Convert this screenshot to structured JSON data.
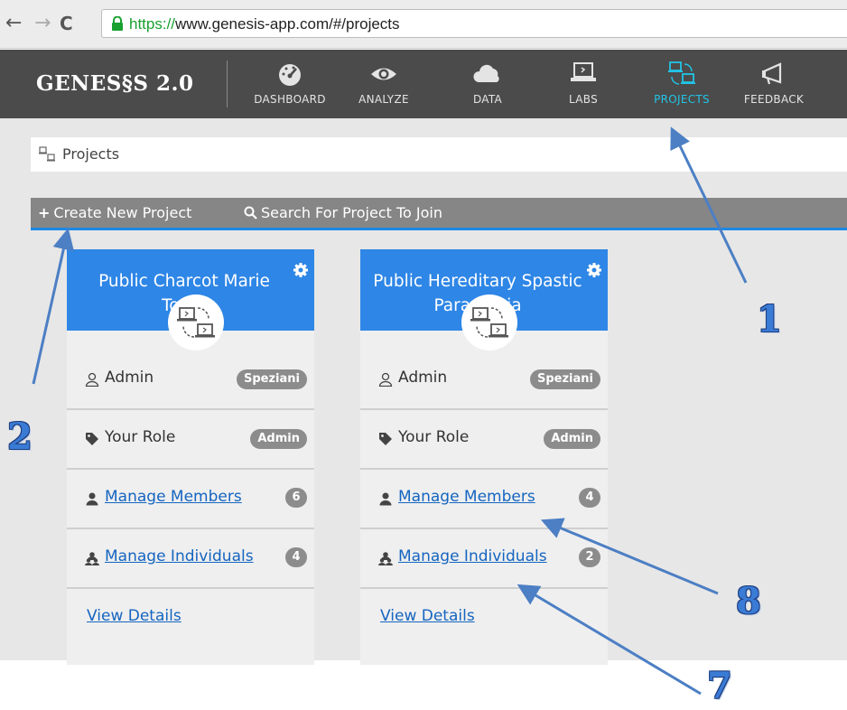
{
  "browser": {
    "url_scheme": "https://",
    "url_rest": "www.genesis-app.com/#/projects"
  },
  "app": {
    "logo": "GENES§S 2.0",
    "nav": [
      {
        "label": "DASHBOARD",
        "icon": "dashboard-icon",
        "active": false
      },
      {
        "label": "ANALYZE",
        "icon": "eye-icon",
        "active": false
      },
      {
        "label": "DATA",
        "icon": "cloud-icon",
        "active": false
      },
      {
        "label": "LABS",
        "icon": "laptop-icon",
        "active": false
      },
      {
        "label": "PROJECTS",
        "icon": "projects-icon",
        "active": true
      },
      {
        "label": "FEEDBACK",
        "icon": "megaphone-icon",
        "active": false
      }
    ]
  },
  "breadcrumb": {
    "label": "Projects"
  },
  "toolbar": {
    "create_label": "Create New Project",
    "search_label": "Search For Project To Join"
  },
  "cards": [
    {
      "title": "Public Charcot Marie Tooth",
      "admin_label": "Admin",
      "admin_value": "Speziani",
      "role_label": "Your Role",
      "role_value": "Admin",
      "members_label": "Manage Members",
      "members_count": "6",
      "individuals_label": "Manage Individuals",
      "individuals_count": "4",
      "details_label": "View Details"
    },
    {
      "title": "Public Hereditary Spastic Paraplegia",
      "admin_label": "Admin",
      "admin_value": "Speziani",
      "role_label": "Your Role",
      "role_value": "Admin",
      "members_label": "Manage Members",
      "members_count": "4",
      "individuals_label": "Manage Individuals",
      "individuals_count": "2",
      "details_label": "View Details"
    }
  ],
  "annotations": [
    "1",
    "2",
    "8",
    "7"
  ],
  "colors": {
    "header_bg": "#4b4b4b",
    "active_nav": "#22c4e5",
    "card_header": "#2e86e6",
    "link": "#1565c0",
    "toolbar_bg": "#868686",
    "annotation": "#3a7bd5"
  }
}
